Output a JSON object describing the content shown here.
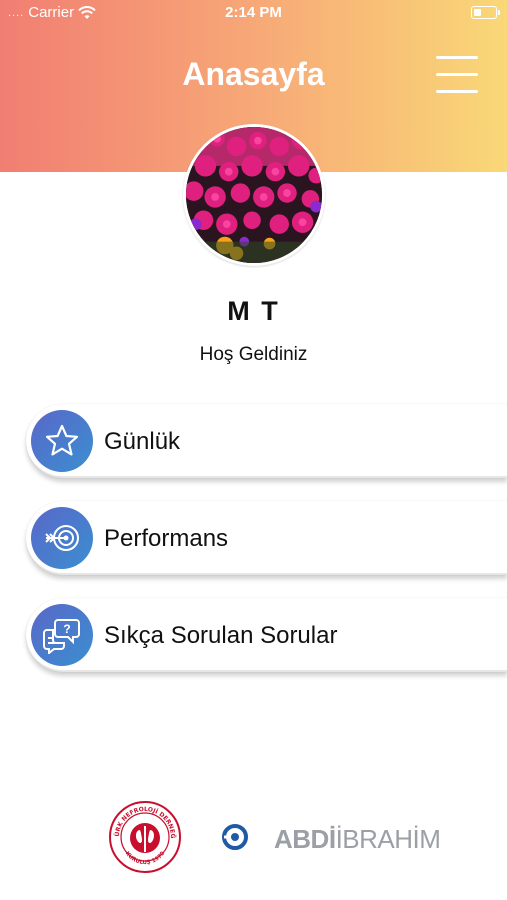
{
  "status_bar": {
    "signal_dots": "....",
    "carrier": "Carrier",
    "time": "2:14 PM",
    "wifi_icon": "wifi-icon",
    "battery_icon": "battery-icon"
  },
  "header": {
    "title": "Anasayfa",
    "menu_icon": "hamburger-menu-icon",
    "gradient": [
      "#f17e72",
      "#f7a877",
      "#f9d877"
    ]
  },
  "profile": {
    "name": "M T",
    "greeting": "Hoş Geldiniz"
  },
  "menu": {
    "items": [
      {
        "label": "Günlük",
        "icon": "star-icon"
      },
      {
        "label": "Performans",
        "icon": "target-icon"
      },
      {
        "label": "Sıkça Sorulan Sorular",
        "icon": "faq-chat-icon"
      }
    ],
    "icon_gradient": [
      "#5a67c9",
      "#3a8fd0"
    ]
  },
  "footer": {
    "logo_left": "turk-nefroloji-dernegi-logo",
    "logo_left_text_top": "TÜRK NEFROLOJİ DERNEĞİ",
    "logo_left_text_bottom": "KURULUŞ 1970",
    "brand_bold": "ABDİ",
    "brand_thin": "İBRAHİM"
  }
}
